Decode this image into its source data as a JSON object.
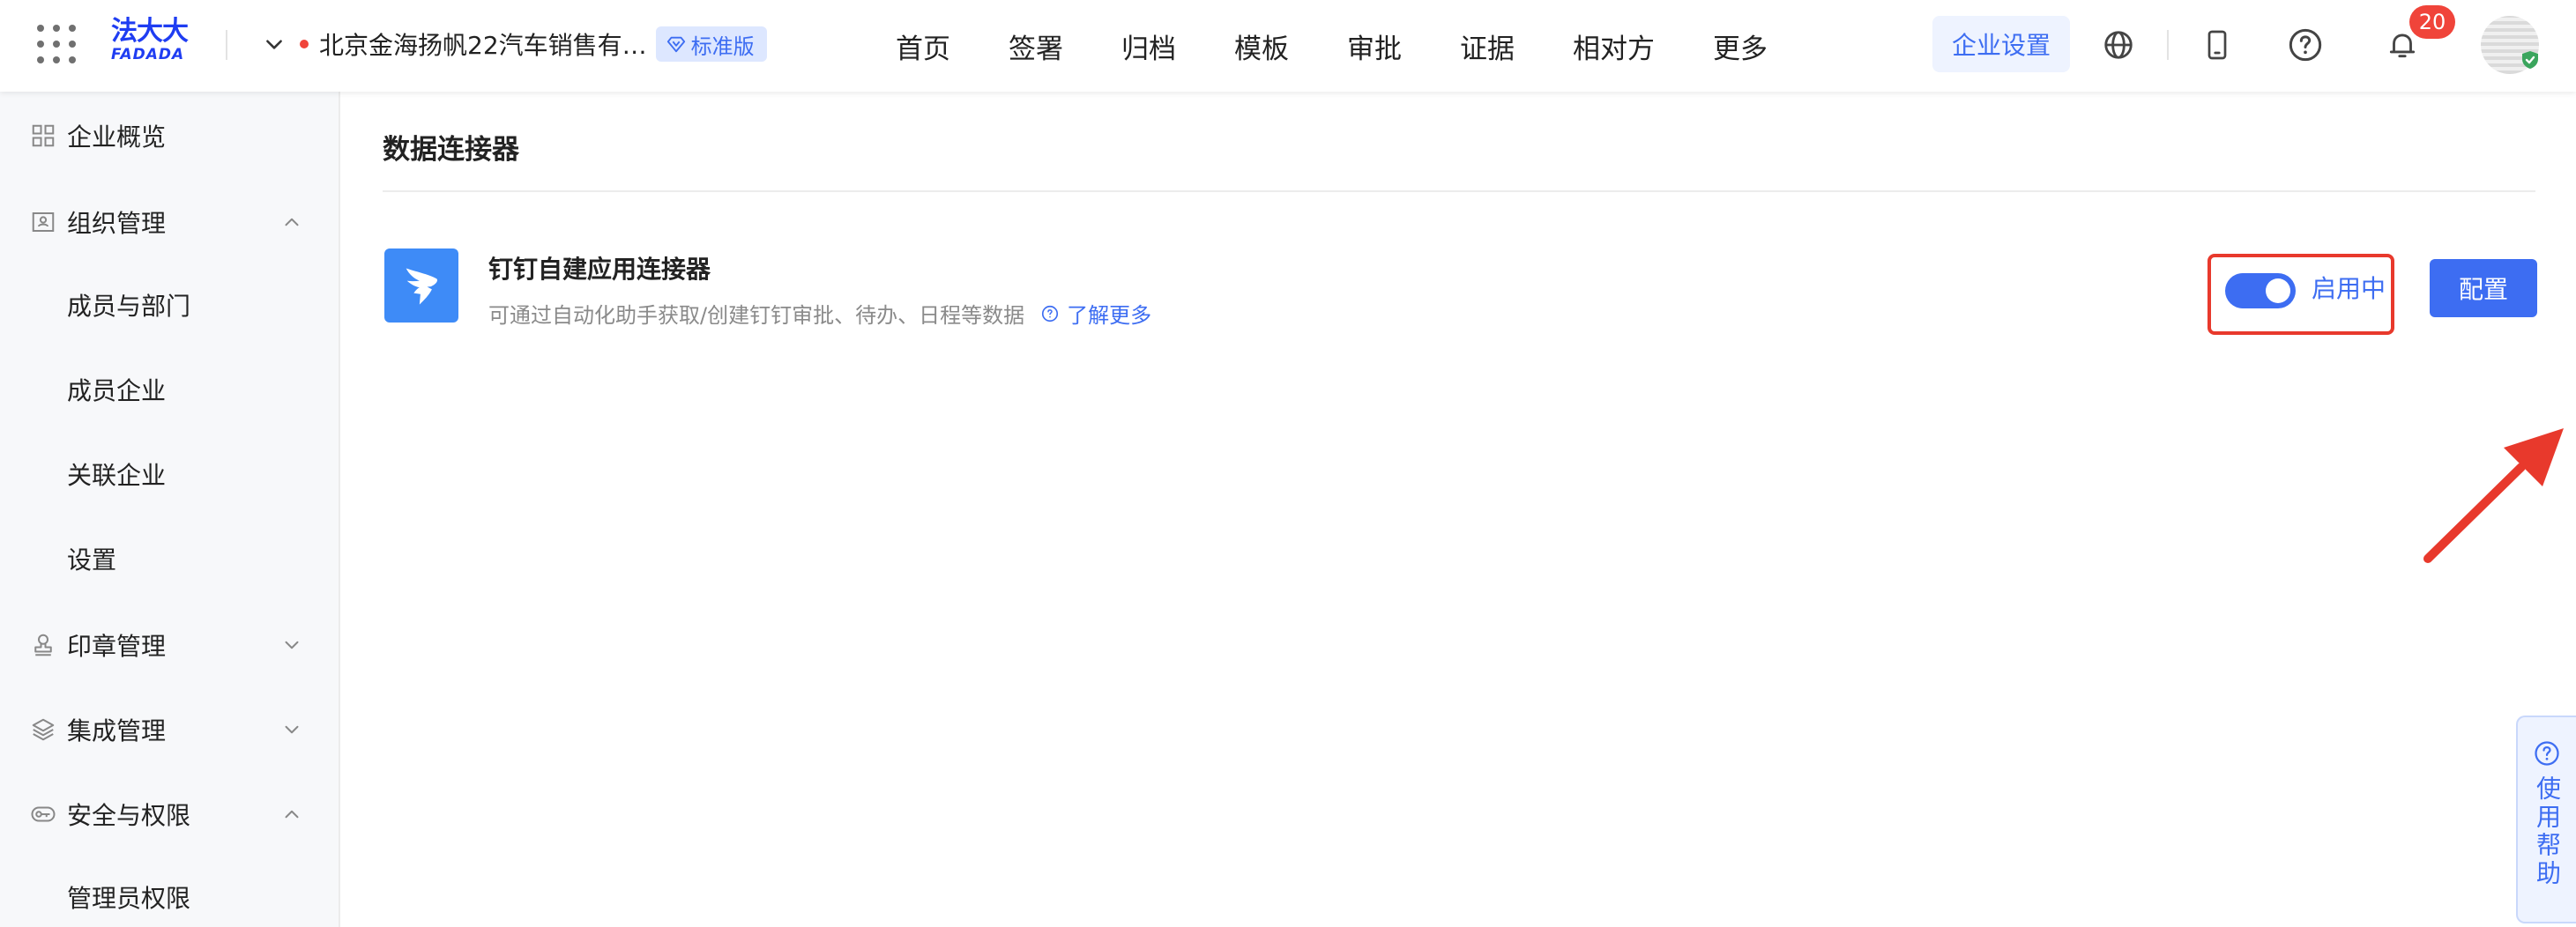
{
  "header": {
    "logo_cn": "法大大",
    "logo_en": "FADADA",
    "company_name": "北京金海扬帆22汽车销售有…",
    "edition": "标准版",
    "nav": [
      "首页",
      "签署",
      "归档",
      "模板",
      "审批",
      "证据",
      "相对方",
      "更多"
    ],
    "enterprise_settings": "企业设置",
    "notification_count": "20"
  },
  "sidebar": {
    "overview": "企业概览",
    "org": "组织管理",
    "members_depts": "成员与部门",
    "member_companies": "成员企业",
    "related_companies": "关联企业",
    "settings": "设置",
    "seal": "印章管理",
    "integration": "集成管理",
    "security": "安全与权限",
    "admin_permissions": "管理员权限"
  },
  "main": {
    "title": "数据连接器",
    "connector": {
      "name": "钉钉自建应用连接器",
      "description": "可通过自动化助手获取/创建钉钉审批、待办、日程等数据",
      "learn_more": "了解更多",
      "status": "启用中",
      "enabled": true,
      "config": "配置"
    }
  },
  "help": "使用帮助",
  "colors": {
    "brand_blue": "#3d6df2",
    "logo_blue": "#1f3df2",
    "badge_red": "#f0443a",
    "annotation_red": "#e8392c"
  }
}
